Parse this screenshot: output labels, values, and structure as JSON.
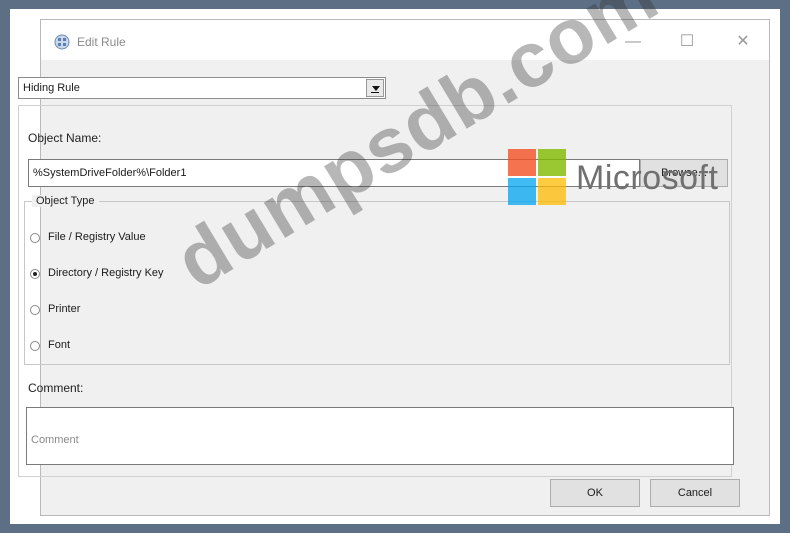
{
  "window": {
    "title": "Edit Rule",
    "controls": {
      "minimize": "—",
      "maximize": "☐",
      "close": "✕"
    }
  },
  "rule_type": {
    "selected": "Hiding Rule"
  },
  "object_name": {
    "label": "Object Name:",
    "value": "%SystemDriveFolder%\\Folder1",
    "browse_label": "Browse..."
  },
  "object_type": {
    "legend": "Object Type",
    "options": [
      {
        "label": "File / Registry Value",
        "checked": false
      },
      {
        "label": "Directory / Registry Key",
        "checked": true
      },
      {
        "label": "Printer",
        "checked": false
      },
      {
        "label": "Font",
        "checked": false
      }
    ]
  },
  "comment": {
    "label": "Comment:",
    "placeholder": "Comment"
  },
  "buttons": {
    "ok": "OK",
    "cancel": "Cancel"
  },
  "overlay": {
    "brand": "Microsoft",
    "watermark": "dumpsdb.com"
  },
  "colors": {
    "background": "#5d6f84",
    "window": "#f0f0f0"
  }
}
